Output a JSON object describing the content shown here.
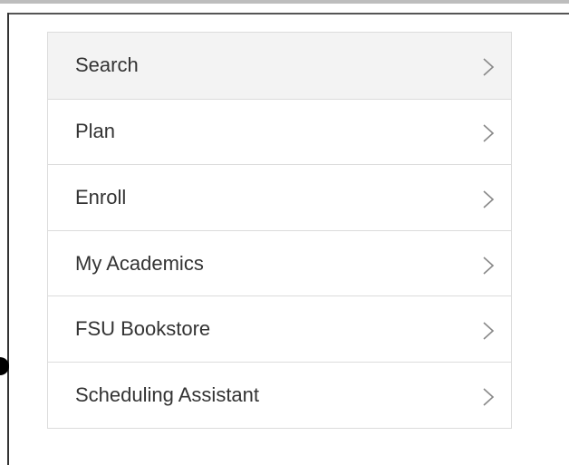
{
  "menu": {
    "items": [
      {
        "label": "Search",
        "icon": "chevron-right-icon"
      },
      {
        "label": "Plan",
        "icon": "chevron-right-icon"
      },
      {
        "label": "Enroll",
        "icon": "chevron-right-icon"
      },
      {
        "label": "My Academics",
        "icon": "chevron-right-icon"
      },
      {
        "label": "FSU Bookstore",
        "icon": "chevron-right-icon"
      },
      {
        "label": "Scheduling Assistant",
        "icon": "chevron-right-icon"
      }
    ]
  },
  "colors": {
    "selected_row_background": "#f3f3f3",
    "row_border": "#dcdcdc",
    "text": "#333333",
    "chevron": "#888888"
  }
}
